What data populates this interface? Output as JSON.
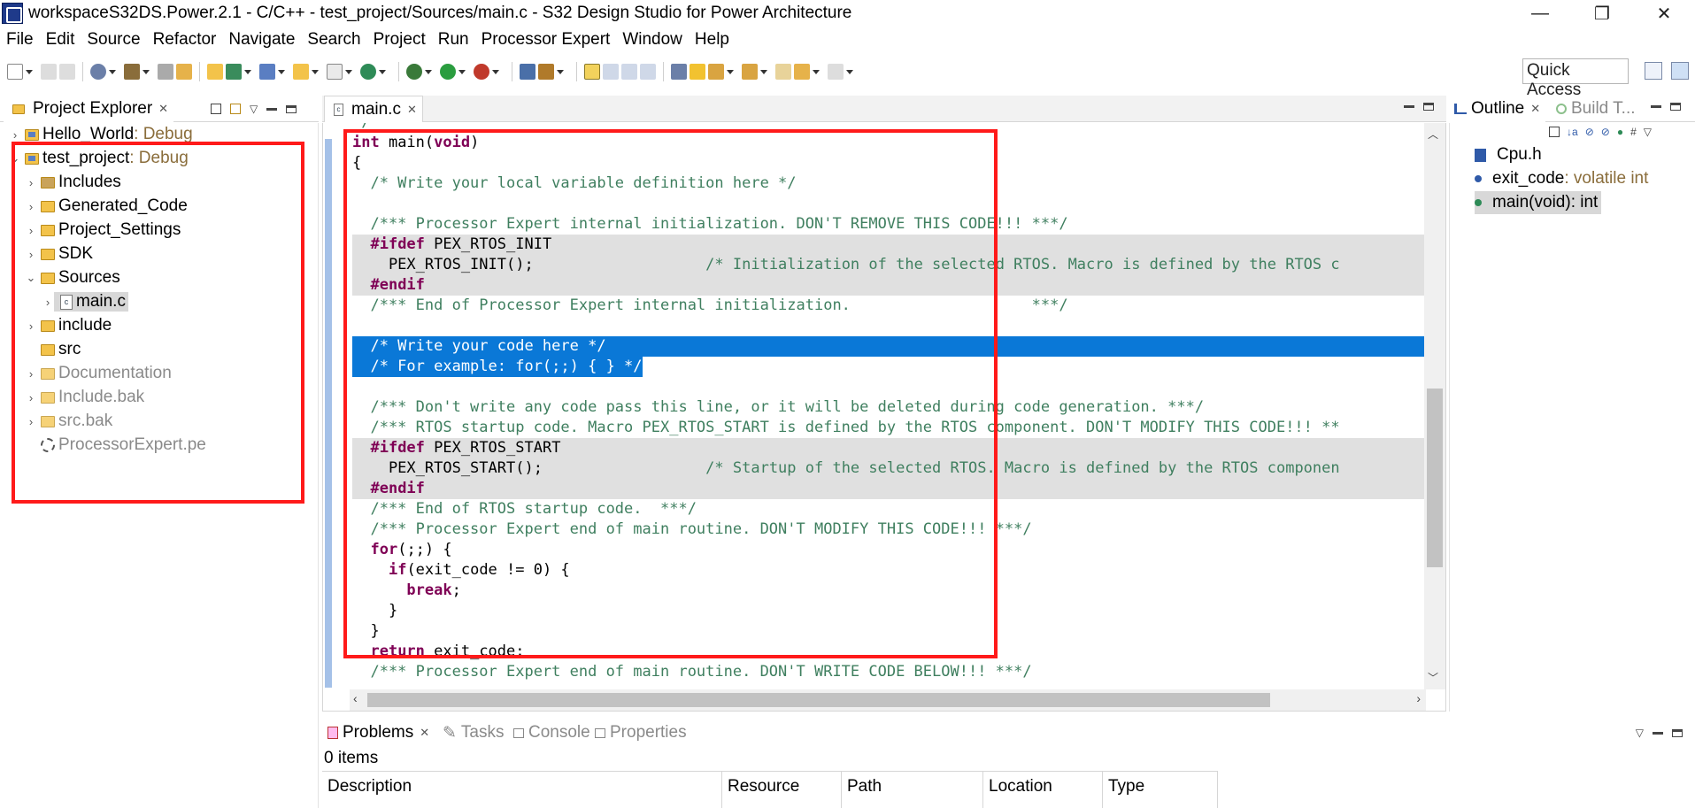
{
  "window": {
    "title": "workspaceS32DS.Power.2.1 - C/C++ - test_project/Sources/main.c - S32 Design Studio for Power Architecture",
    "controls": {
      "minimize": "—",
      "maximize": "❐",
      "close": "✕"
    }
  },
  "menu": [
    "File",
    "Edit",
    "Source",
    "Refactor",
    "Navigate",
    "Search",
    "Project",
    "Run",
    "Processor Expert",
    "Window",
    "Help"
  ],
  "toolbar": {
    "quick_access": "Quick Access"
  },
  "explorer": {
    "tab_label": "Project Explorer",
    "items": [
      {
        "label": "Hello_World",
        "suffix": ": Debug"
      },
      {
        "label": "test_project",
        "suffix": ": Debug"
      },
      {
        "label": "Includes"
      },
      {
        "label": "Generated_Code"
      },
      {
        "label": "Project_Settings"
      },
      {
        "label": "SDK"
      },
      {
        "label": "Sources"
      },
      {
        "label": "main.c"
      },
      {
        "label": "include"
      },
      {
        "label": "src"
      },
      {
        "label": "Documentation"
      },
      {
        "label": "Include.bak"
      },
      {
        "label": "src.bak"
      },
      {
        "label": "ProcessorExpert.pe"
      }
    ]
  },
  "editor": {
    "tab_label": "main.c",
    "lines": [
      {
        "segments": [
          {
            "t": "*/",
            "c": "cm"
          }
        ]
      },
      {
        "segments": [
          {
            "t": "int",
            "c": "kw"
          },
          {
            "t": " main("
          },
          {
            "t": "void",
            "c": "kw"
          },
          {
            "t": ")"
          }
        ]
      },
      {
        "segments": [
          {
            "t": "{"
          }
        ]
      },
      {
        "segments": [
          {
            "t": "  /* Write your local variable definition here */",
            "c": "cm"
          }
        ]
      },
      {
        "segments": [
          {
            "t": ""
          }
        ]
      },
      {
        "segments": [
          {
            "t": "  /*** Processor Expert internal initialization. DON'T REMOVE THIS CODE!!! ***/",
            "c": "cm"
          }
        ]
      },
      {
        "segments": [
          {
            "t": "  "
          },
          {
            "t": "#ifdef",
            "c": "pp"
          },
          {
            "t": " PEX_RTOS_INIT"
          }
        ],
        "bg": "gray"
      },
      {
        "segments": [
          {
            "t": "    PEX_RTOS_INIT();                   "
          },
          {
            "t": "/* Initialization of the selected RTOS. Macro is defined by the RTOS c",
            "c": "cm"
          }
        ],
        "bg": "gray"
      },
      {
        "segments": [
          {
            "t": "  "
          },
          {
            "t": "#endif",
            "c": "pp"
          }
        ],
        "bg": "gray"
      },
      {
        "segments": [
          {
            "t": "  /*** End of Processor Expert internal initialization.                    ***/",
            "c": "cm"
          }
        ]
      },
      {
        "segments": [
          {
            "t": ""
          }
        ]
      },
      {
        "segments": [
          {
            "t": "  /* Write your code here */",
            "c": "cm"
          }
        ],
        "bg": "sel"
      },
      {
        "segments": [
          {
            "t": "  /* For example: for(;;) { } */",
            "c": "cm"
          }
        ],
        "bg": "sel-partial"
      },
      {
        "segments": [
          {
            "t": ""
          }
        ]
      },
      {
        "segments": [
          {
            "t": "  /*** Don't write any code pass this line, or it will be deleted during code generation. ***/",
            "c": "cm"
          }
        ]
      },
      {
        "segments": [
          {
            "t": "  /*** RTOS startup code. Macro PEX_RTOS_START is defined by the RTOS component. DON'T MODIFY THIS CODE!!! **",
            "c": "cm"
          }
        ]
      },
      {
        "segments": [
          {
            "t": "  "
          },
          {
            "t": "#ifdef",
            "c": "pp"
          },
          {
            "t": " PEX_RTOS_START"
          }
        ],
        "bg": "gray"
      },
      {
        "segments": [
          {
            "t": "    PEX_RTOS_START();                  "
          },
          {
            "t": "/* Startup of the selected RTOS. Macro is defined by the RTOS componen",
            "c": "cm"
          }
        ],
        "bg": "gray"
      },
      {
        "segments": [
          {
            "t": "  "
          },
          {
            "t": "#endif",
            "c": "pp"
          }
        ],
        "bg": "gray"
      },
      {
        "segments": [
          {
            "t": "  /*** End of RTOS startup code.  ***/",
            "c": "cm"
          }
        ]
      },
      {
        "segments": [
          {
            "t": "  /*** Processor Expert end of main routine. DON'T MODIFY THIS CODE!!! ***/",
            "c": "cm"
          }
        ]
      },
      {
        "segments": [
          {
            "t": "  "
          },
          {
            "t": "for",
            "c": "kw"
          },
          {
            "t": "(;;) {"
          }
        ]
      },
      {
        "segments": [
          {
            "t": "    "
          },
          {
            "t": "if",
            "c": "kw"
          },
          {
            "t": "(exit_code != 0) {"
          }
        ]
      },
      {
        "segments": [
          {
            "t": "      "
          },
          {
            "t": "break",
            "c": "kw"
          },
          {
            "t": ";"
          }
        ]
      },
      {
        "segments": [
          {
            "t": "    }"
          }
        ]
      },
      {
        "segments": [
          {
            "t": "  }"
          }
        ]
      },
      {
        "segments": [
          {
            "t": "  "
          },
          {
            "t": "return",
            "c": "kw"
          },
          {
            "t": " exit_code;"
          }
        ]
      },
      {
        "segments": [
          {
            "t": "  /*** Processor Expert end of main routine. DON'T WRITE CODE BELOW!!! ***/",
            "c": "cm"
          }
        ]
      }
    ]
  },
  "outline": {
    "tab_label": "Outline",
    "tab2_label": "Build T...",
    "items": [
      {
        "name": "Cpu.h",
        "type": ""
      },
      {
        "name": "exit_code",
        "type": " : volatile int"
      },
      {
        "name": "main(void)",
        "type": " : int"
      }
    ]
  },
  "problems": {
    "tabs": [
      "Problems",
      "Tasks",
      "Console",
      "Properties"
    ],
    "count": "0 items",
    "columns": [
      "Description",
      "Resource",
      "Path",
      "Location",
      "Type"
    ]
  }
}
